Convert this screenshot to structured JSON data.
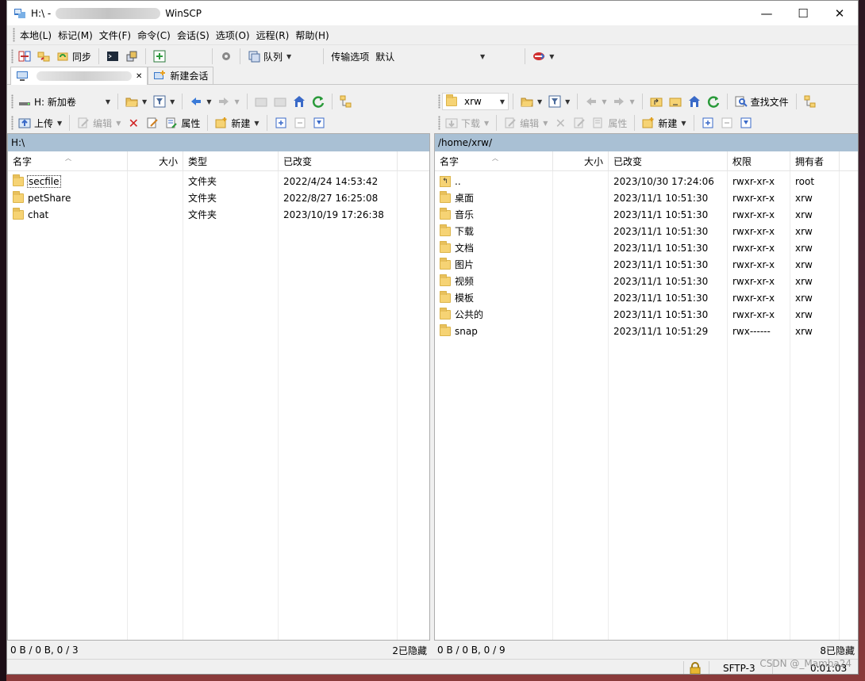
{
  "window": {
    "title_prefix": "H:\\ -",
    "title_suffix": "WinSCP",
    "minimize": "—",
    "maximize": "☐",
    "close": "✕"
  },
  "menu": [
    "本地(L)",
    "标记(M)",
    "文件(F)",
    "命令(C)",
    "会话(S)",
    "选项(O)",
    "远程(R)",
    "帮助(H)"
  ],
  "toolbar": {
    "sync_label": "同步",
    "queue_label": "队列",
    "transfer_label": "传输选项",
    "transfer_value": "默认"
  },
  "tabs": {
    "session_label": "",
    "new_session_label": "新建会话",
    "close_glyph": "✕"
  },
  "left": {
    "drive": "H: 新加卷",
    "upload_label": "上传",
    "edit_label": "编辑",
    "properties_label": "属性",
    "new_label": "新建",
    "path": "H:\\",
    "columns": [
      "名字",
      "大小",
      "类型",
      "已改变"
    ],
    "files": [
      {
        "name": "secfile",
        "size": "",
        "type": "文件夹",
        "changed": "2022/4/24  14:53:42"
      },
      {
        "name": "petShare",
        "size": "",
        "type": "文件夹",
        "changed": "2022/8/27  16:25:08"
      },
      {
        "name": "chat",
        "size": "",
        "type": "文件夹",
        "changed": "2023/10/19  17:26:38"
      }
    ],
    "status": "0 B / 0 B,   0 / 3",
    "hidden": "2已隐藏"
  },
  "right": {
    "dir": "xrw",
    "download_label": "下载",
    "edit_label": "编辑",
    "properties_label": "属性",
    "new_label": "新建",
    "find_label": "查找文件",
    "path": "/home/xrw/",
    "columns": [
      "名字",
      "大小",
      "已改变",
      "权限",
      "拥有者"
    ],
    "files": [
      {
        "name": "..",
        "size": "",
        "changed": "2023/10/30 17:24:06",
        "rights": "rwxr-xr-x",
        "owner": "root",
        "parent": true
      },
      {
        "name": "桌面",
        "size": "",
        "changed": "2023/11/1 10:51:30",
        "rights": "rwxr-xr-x",
        "owner": "xrw"
      },
      {
        "name": "音乐",
        "size": "",
        "changed": "2023/11/1 10:51:30",
        "rights": "rwxr-xr-x",
        "owner": "xrw"
      },
      {
        "name": "下载",
        "size": "",
        "changed": "2023/11/1 10:51:30",
        "rights": "rwxr-xr-x",
        "owner": "xrw"
      },
      {
        "name": "文档",
        "size": "",
        "changed": "2023/11/1 10:51:30",
        "rights": "rwxr-xr-x",
        "owner": "xrw"
      },
      {
        "name": "图片",
        "size": "",
        "changed": "2023/11/1 10:51:30",
        "rights": "rwxr-xr-x",
        "owner": "xrw"
      },
      {
        "name": "视频",
        "size": "",
        "changed": "2023/11/1 10:51:30",
        "rights": "rwxr-xr-x",
        "owner": "xrw"
      },
      {
        "name": "模板",
        "size": "",
        "changed": "2023/11/1 10:51:30",
        "rights": "rwxr-xr-x",
        "owner": "xrw"
      },
      {
        "name": "公共的",
        "size": "",
        "changed": "2023/11/1 10:51:30",
        "rights": "rwxr-xr-x",
        "owner": "xrw"
      },
      {
        "name": "snap",
        "size": "",
        "changed": "2023/11/1 10:51:29",
        "rights": "rwx------",
        "owner": "xrw"
      }
    ],
    "status": "0 B / 0 B,   0 / 9",
    "hidden": "8已隐藏"
  },
  "bottom": {
    "protocol": "SFTP-3",
    "elapsed": "0:01:03"
  },
  "watermark": "CSDN @_Mamba24"
}
